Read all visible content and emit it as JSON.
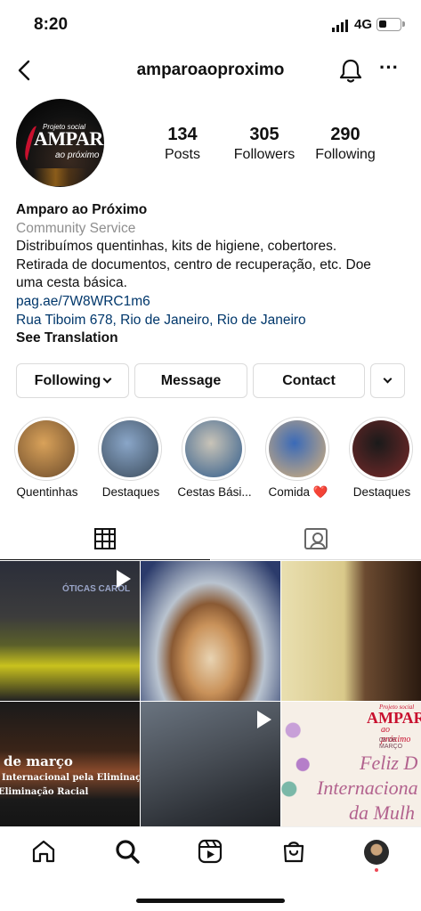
{
  "status_bar": {
    "time": "8:20",
    "network": "4G",
    "battery_level": 0.35
  },
  "header": {
    "username": "amparoaoproximo"
  },
  "profile": {
    "avatar": {
      "small_text": "Projeto social",
      "big_text": "AMPARO",
      "sub_text": "ao próximo"
    },
    "stats": [
      {
        "value": "134",
        "label": "Posts"
      },
      {
        "value": "305",
        "label": "Followers"
      },
      {
        "value": "290",
        "label": "Following"
      }
    ]
  },
  "bio": {
    "name": "Amparo ao Próximo",
    "category": "Community Service",
    "text_lines": [
      "Distribuímos quentinhas, kits de higiene, cobertores.",
      "Retirada de documentos, centro de recuperação, etc. Doe",
      "uma cesta básica."
    ],
    "link": "pag.ae/7W8WRC1m6",
    "address": "Rua Tiboim 678, Rio de Janeiro, Rio de Janeiro",
    "see_translation": "See Translation"
  },
  "actions": {
    "following": "Following",
    "message": "Message",
    "contact": "Contact"
  },
  "highlights": [
    {
      "label": "Quentinhas",
      "colors": [
        "#d9a25a",
        "#6b4a2a"
      ]
    },
    {
      "label": "Destaques",
      "colors": [
        "#8aa6c8",
        "#3a4a5a"
      ]
    },
    {
      "label": "Cestas Bási...",
      "colors": [
        "#c9c4b8",
        "#2e5a8a"
      ]
    },
    {
      "label": "Comida ❤️",
      "colors": [
        "#3a6ab8",
        "#d9b27a"
      ]
    },
    {
      "label": "Destaques",
      "colors": [
        "#1a1a1a",
        "#7a2a2a"
      ]
    }
  ],
  "posts": {
    "p1": {
      "sign": "ÓTICAS CAROL"
    },
    "p4": {
      "lines": [
        "de março",
        "Internacional pela Eliminação da",
        "Eliminação Racial"
      ]
    },
    "p6": {
      "brand_small": "Projeto social",
      "brand": "AMPARO",
      "brand_sub": "ao próximo",
      "date": "08 DE MARÇO",
      "lines": [
        "Feliz D",
        "Internaciona",
        "da Mulh"
      ]
    }
  }
}
